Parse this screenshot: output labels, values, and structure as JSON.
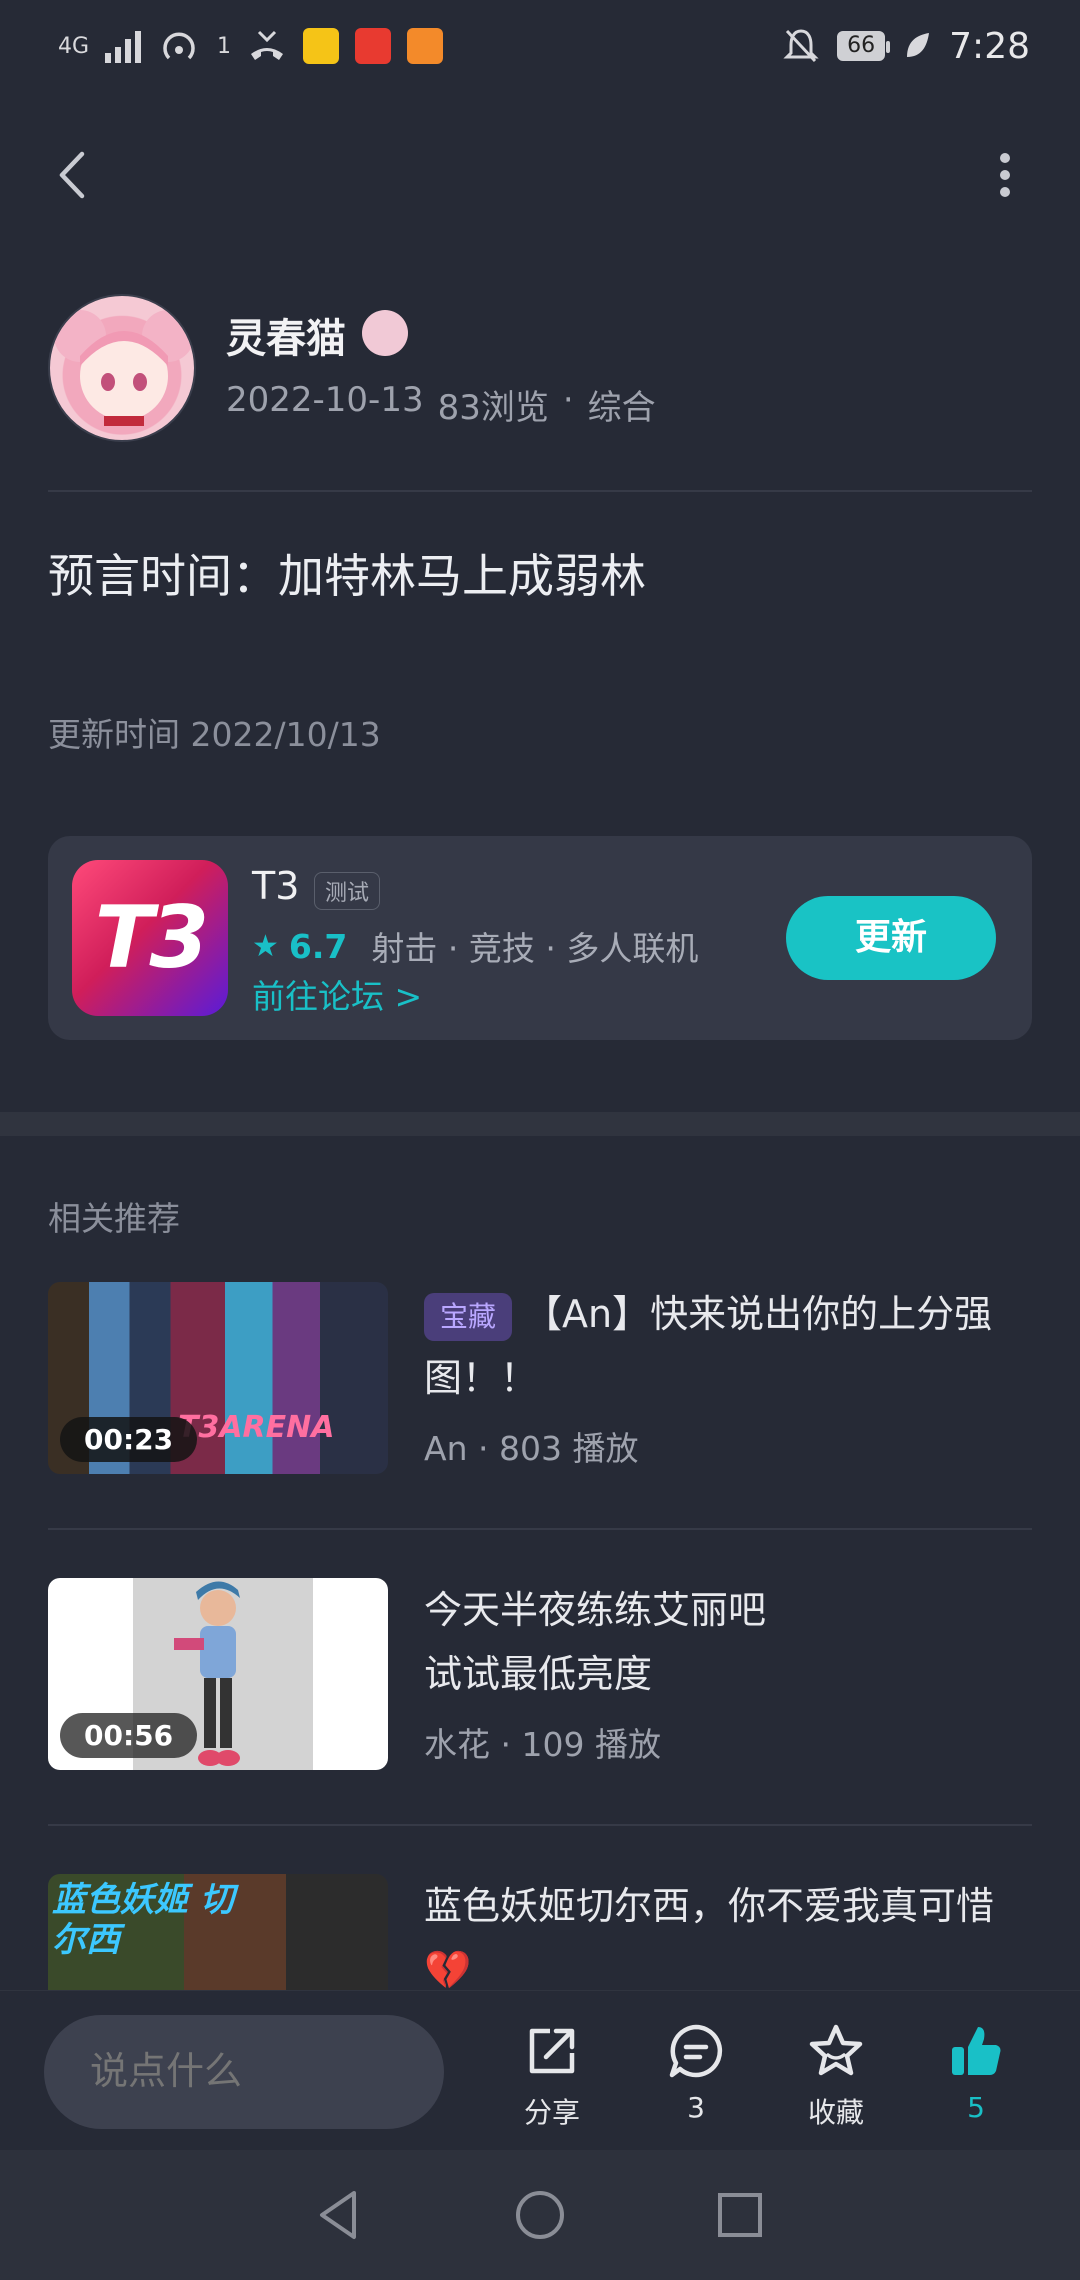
{
  "status_bar": {
    "network": "4G",
    "hotspot_count": "1",
    "battery": "66",
    "time": "7:28"
  },
  "author": {
    "name": "灵春猫",
    "date": "2022-10-13",
    "views": "83浏览",
    "category": "综合"
  },
  "post": {
    "title": "预言时间：加特林马上成弱林",
    "update_time": "更新时间 2022/10/13"
  },
  "game": {
    "icon_text": "T3",
    "name": "T3",
    "tag": "测试",
    "rating": "6.7",
    "genres": "射击 · 竞技 · 多人联机",
    "forum_link": "前往论坛 >",
    "update_button": "更新"
  },
  "related": {
    "label": "相关推荐",
    "items": [
      {
        "tag": "宝藏",
        "title": "【An】快来说出你的上分强图！！",
        "author": "An",
        "plays": "803 播放",
        "duration": "00:23",
        "thumb_caption": "T3ARENA"
      },
      {
        "title_line1": "今天半夜练练艾丽吧",
        "title_line2": "试试最低亮度",
        "author": "水花",
        "plays": "109 播放",
        "duration": "00:56"
      },
      {
        "title": "蓝色妖姬切尔西，你不爱我真可惜💔",
        "thumb_caption": "蓝色妖姬 切尔西"
      }
    ]
  },
  "bottom_bar": {
    "input_placeholder": "说点什么",
    "share_label": "分享",
    "comment_count": "3",
    "favorite_label": "收藏",
    "like_count": "5"
  },
  "colors": {
    "accent": "#19c0c7",
    "background": "#262a36",
    "card": "#353947"
  }
}
